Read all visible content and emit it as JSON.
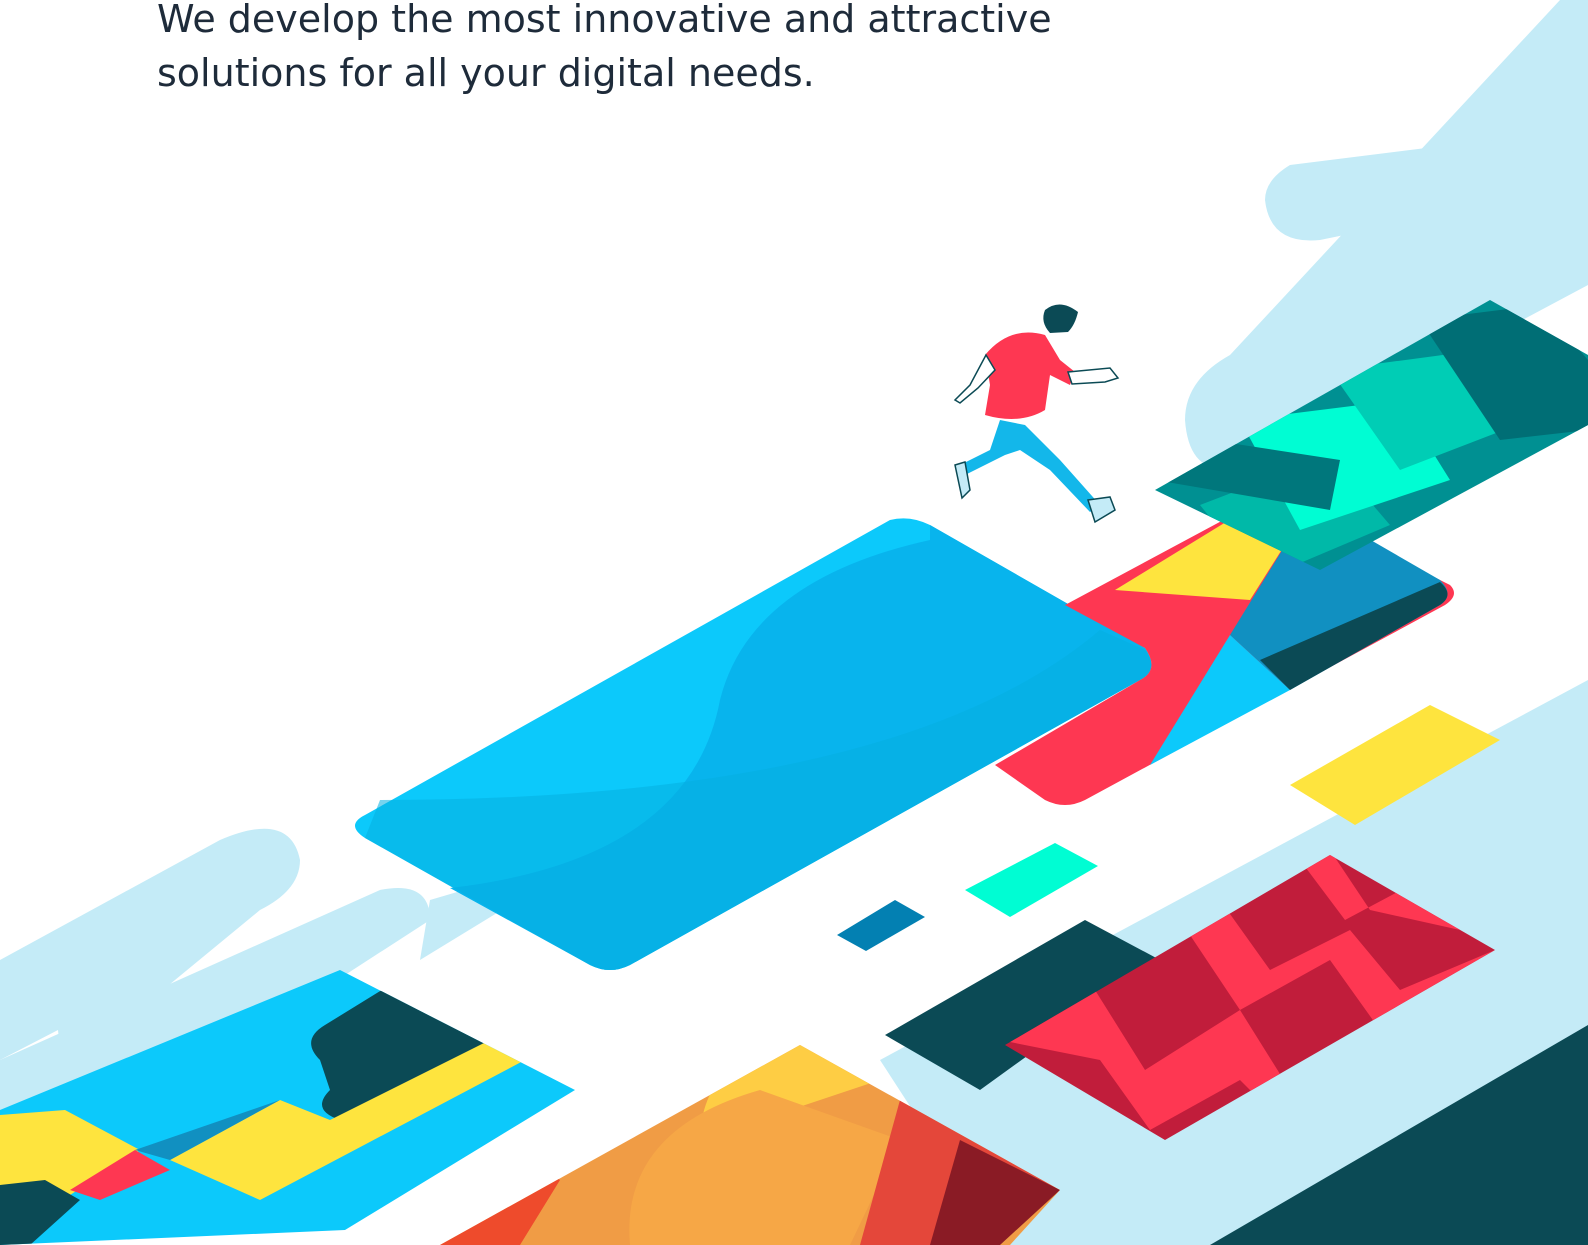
{
  "hero": {
    "tagline_line1": "We develop the most innovative and attractive",
    "tagline_line2": "solutions for all your digital needs."
  },
  "colors": {
    "text": "#1e2b3a",
    "sky_band": "#c4ebf7",
    "cyan": "#0cc9fb",
    "blue": "#08b4ed",
    "deep_blue": "#1190c1",
    "red": "#fe3752",
    "yellow": "#fee43e",
    "dark_teal": "#0b4a55",
    "mint": "#00fdd3",
    "crimson": "#c11d3b",
    "orange": "#f09c45"
  },
  "illustration": {
    "subject": "running-person-icon"
  }
}
